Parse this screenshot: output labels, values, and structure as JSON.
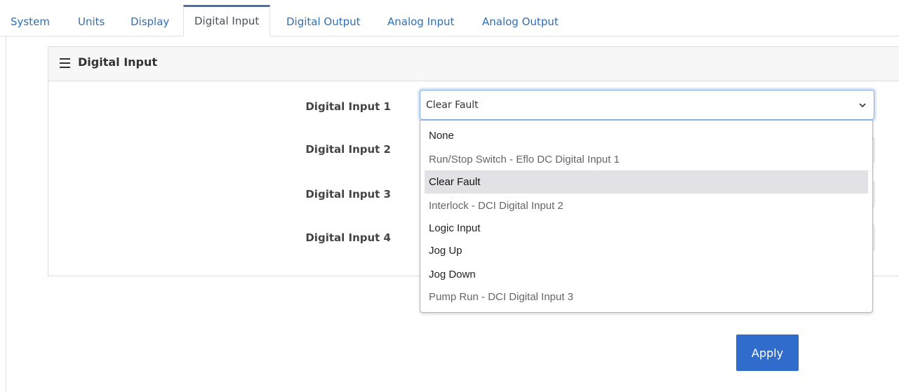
{
  "tabs": [
    {
      "label": "System"
    },
    {
      "label": "Units"
    },
    {
      "label": "Display"
    },
    {
      "label": "Digital Input"
    },
    {
      "label": "Digital Output"
    },
    {
      "label": "Analog Input"
    },
    {
      "label": "Analog Output"
    }
  ],
  "active_tab": "Digital Input",
  "card": {
    "icon": "hamburger-menu-icon",
    "title": "Digital Input"
  },
  "inputs": [
    {
      "label": "Digital Input 1",
      "value": "Clear Fault"
    },
    {
      "label": "Digital Input 2",
      "value": ""
    },
    {
      "label": "Digital Input 3",
      "value": ""
    },
    {
      "label": "Digital Input 4",
      "value": ""
    }
  ],
  "dropdown": {
    "open_for": "Digital Input 1",
    "selected": "Clear Fault",
    "options": [
      "None",
      "Run/Stop Switch - Eflo DC Digital Input 1",
      "Clear Fault",
      "Interlock - DCI Digital Input 2",
      "Logic Input",
      "Jog Up",
      "Jog Down",
      "Pump Run - DCI Digital Input 3"
    ]
  },
  "apply_label": "Apply",
  "colors": {
    "accent": "#2f6ccb",
    "tab_link": "#2f6fb5",
    "option_highlight": "#e2e1e6"
  }
}
